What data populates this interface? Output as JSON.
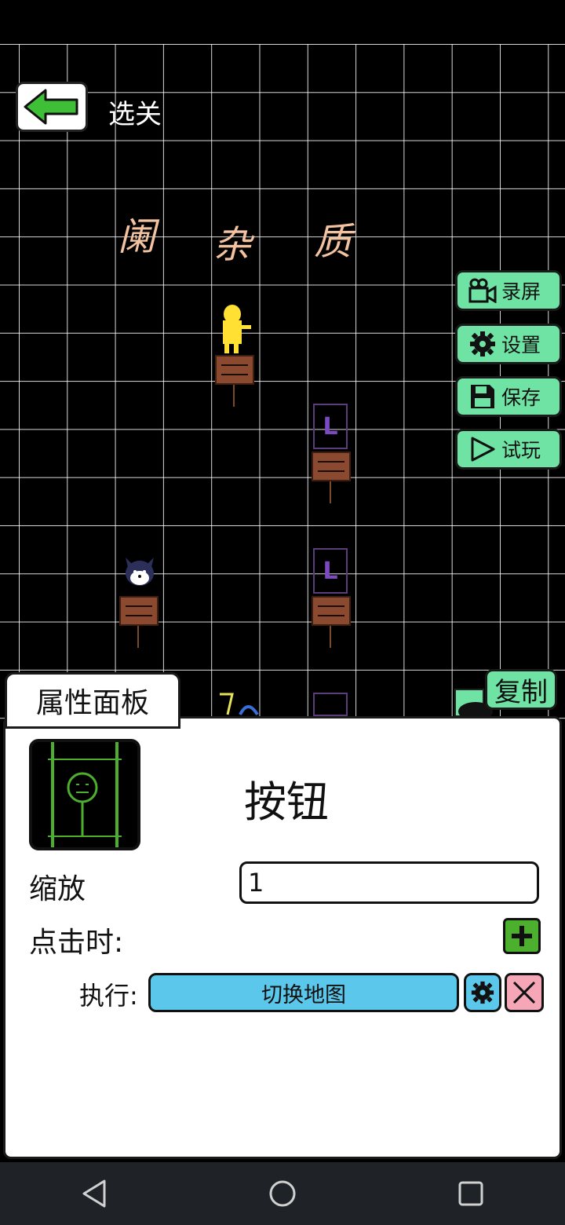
{
  "header": {
    "back_label": "选关"
  },
  "scene": {
    "handwritten_chars": [
      "阑",
      "杂",
      "质"
    ],
    "purple_box_label": "L"
  },
  "side_buttons": {
    "record": "录屏",
    "settings": "设置",
    "save": "保存",
    "test_play": "试玩"
  },
  "panel": {
    "tab_label": "属性面板",
    "copy_label": "复制",
    "object_name": "按钮",
    "scale_label": "缩放",
    "scale_value": "1",
    "on_click_label": "点击时:",
    "execute_label": "执行:",
    "action_label": "切换地图"
  },
  "colors": {
    "accent_green": "#6fe3a4",
    "action_blue": "#5bc7ea",
    "delete_pink": "#f5a6b7",
    "add_green": "#4caf2e"
  },
  "icons": {
    "back": "arrow-left-icon",
    "record": "video-camera-icon",
    "settings": "gear-icon",
    "save": "floppy-disk-icon",
    "test_play": "play-icon",
    "nav_back": "triangle-back-icon",
    "nav_home": "circle-home-icon",
    "nav_recents": "square-recents-icon"
  }
}
